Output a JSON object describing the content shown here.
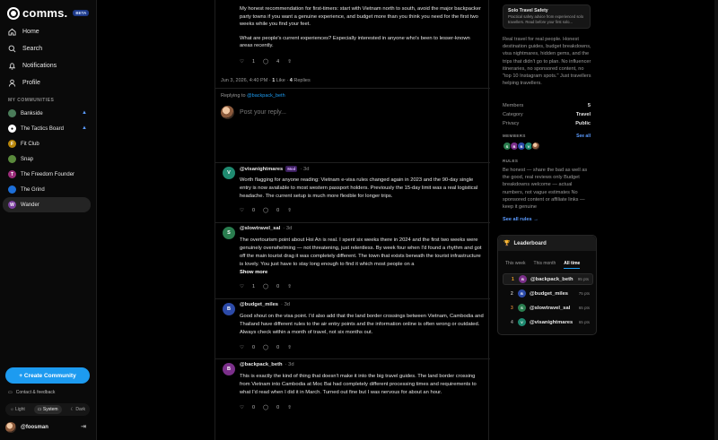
{
  "app": {
    "name": "comms.",
    "badge": "BETA"
  },
  "nav": [
    {
      "label": "Home",
      "icon": "home-icon"
    },
    {
      "label": "Search",
      "icon": "search-icon"
    },
    {
      "label": "Notifications",
      "icon": "bell-icon"
    },
    {
      "label": "Profile",
      "icon": "user-icon"
    }
  ],
  "communities_label": "MY COMMUNITIES",
  "communities": [
    {
      "name": "Bankside",
      "letter": "",
      "color": "#4a7c59",
      "pinned": true
    },
    {
      "name": "The Tactics Board",
      "letter": "",
      "color": "#ffffff",
      "pinned": true
    },
    {
      "name": "Fit Club",
      "letter": "F",
      "color": "#b8860b",
      "pinned": false
    },
    {
      "name": "Snap",
      "letter": "",
      "color": "#5a8a3c",
      "pinned": false
    },
    {
      "name": "The Freedom Founder",
      "letter": "T",
      "color": "#9b2c7a",
      "pinned": false
    },
    {
      "name": "The Grind",
      "letter": "",
      "color": "#1d6fd8",
      "pinned": false
    },
    {
      "name": "Wander",
      "letter": "W",
      "color": "#7b3fa0",
      "pinned": false
    }
  ],
  "create_label": "+ Create Community",
  "contact_label": "Contact & feedback",
  "theme": {
    "light": "Light",
    "system": "System",
    "dark": "Dark"
  },
  "current_user": "@foosman",
  "post": {
    "paragraph1": "My honest recommendation for first-timers: start with Vietnam north to south, avoid the major backpacker party towns if you want a genuine experience, and budget more than you think you need for the first two weeks while you find your feet.",
    "paragraph2": "What are people's current experiences? Especially interested in anyone who's been to lesser-known areas recently.",
    "likes": "1",
    "shares": "4",
    "date": "Jun 3, 2026, 4:40 PM",
    "like_count": "1",
    "like_word": "Like",
    "reply_count": "4",
    "reply_word": "Replies",
    "replying_prefix": "Replying to",
    "replying_to": "@backpack_beth",
    "reply_placeholder": "Post your reply..."
  },
  "comments": [
    {
      "user": "@visanightmares",
      "badge": "Mod",
      "time": "3d",
      "letter": "V",
      "color": "#1f8a70",
      "text": "Worth flagging for anyone reading: Vietnam e-visa rules changed again in 2023 and the 90-day single entry is now available to most western passport holders. Previously the 15-day limit was a real logistical headache. The current setup is much more flexible for longer trips.",
      "show_more": "",
      "likes": "0",
      "shares": "0"
    },
    {
      "user": "@slowtravel_sal",
      "badge": "",
      "time": "3d",
      "letter": "S",
      "color": "#2a7d4f",
      "text": "The overtourism point about Hoi An is real. I spent six weeks there in 2024 and the first two weeks were genuinely overwhelming — not threatening, just relentless. By week four when I'd found a rhythm and got off the main tourist drag it was completely different. The town that exists beneath the tourist infrastructure is lovely. You just have to stay long enough to find it which most people on a",
      "show_more": "Show more",
      "likes": "1",
      "shares": "0"
    },
    {
      "user": "@budget_miles",
      "badge": "",
      "time": "3d",
      "letter": "B",
      "color": "#2c4aa8",
      "text": "Good shout on the visa point. I'd also add that the land border crossings between Vietnam, Cambodia and Thailand have different rules to the air entry points and the information online is often wrong or outdated. Always check within a month of travel, not six months out.",
      "show_more": "",
      "likes": "0",
      "shares": "0"
    },
    {
      "user": "@backpack_beth",
      "badge": "",
      "time": "3d",
      "letter": "B",
      "color": "#7b2f8a",
      "text": "This is exactly the kind of thing that doesn't make it into the big travel guides. The land border crossing from Vietnam into Cambodia at Moc Bai had completely different processing times and requirements to what I'd read when I did it in March. Turned out fine but I was nervous for about an hour.",
      "show_more": "",
      "likes": "0",
      "shares": "0"
    }
  ],
  "right": {
    "safety_title": "Solo Travel Safety",
    "safety_sub": "Practical safety advice from experienced solo travellers. Read before your first solo...",
    "about": "Real travel for real people. Honest destination guides, budget breakdowns, visa nightmares, hidden gems, and the trips that didn't go to plan. No influencer itineraries, no sponsored content, no \"top 10 Instagram spots.\" Just travellers helping travellers.",
    "stats": [
      {
        "key": "Members",
        "value": "5"
      },
      {
        "key": "Category",
        "value": "Travel"
      },
      {
        "key": "Privacy",
        "value": "Public"
      }
    ],
    "members_label": "MEMBERS",
    "see_all": "See all",
    "member_avatars": [
      {
        "letter": "S",
        "color": "#2a7d4f"
      },
      {
        "letter": "B",
        "color": "#7b2f8a"
      },
      {
        "letter": "B",
        "color": "#2c4aa8"
      },
      {
        "letter": "V",
        "color": "#1f8a70"
      },
      {
        "letter": "",
        "color": "#c9a37a"
      }
    ],
    "rules_label": "RULES",
    "rules": "Be honest — share the bad as well as the good, real reviews only Budget breakdowns welcome — actual numbers, not vague estimates No sponsored content or affiliate links — keep it genuine",
    "see_rules": "See all rules →"
  },
  "leaderboard": {
    "title": "Leaderboard",
    "tabs": [
      "This week",
      "This month",
      "All time"
    ],
    "rows": [
      {
        "rank": "1",
        "user": "@backpack_beth",
        "pts": "95 pts",
        "letter": "B",
        "color": "#7b2f8a",
        "rank_color": "#f5a524"
      },
      {
        "rank": "2",
        "user": "@budget_miles",
        "pts": "75 pts",
        "letter": "B",
        "color": "#2c4aa8",
        "rank_color": "#bbbbbb"
      },
      {
        "rank": "3",
        "user": "@slowtravel_sal",
        "pts": "65 pts",
        "letter": "S",
        "color": "#2a7d4f",
        "rank_color": "#cd7f32"
      },
      {
        "rank": "4",
        "user": "@visanightmares",
        "pts": "65 pts",
        "letter": "V",
        "color": "#1f8a70",
        "rank_color": "#999999"
      }
    ]
  }
}
